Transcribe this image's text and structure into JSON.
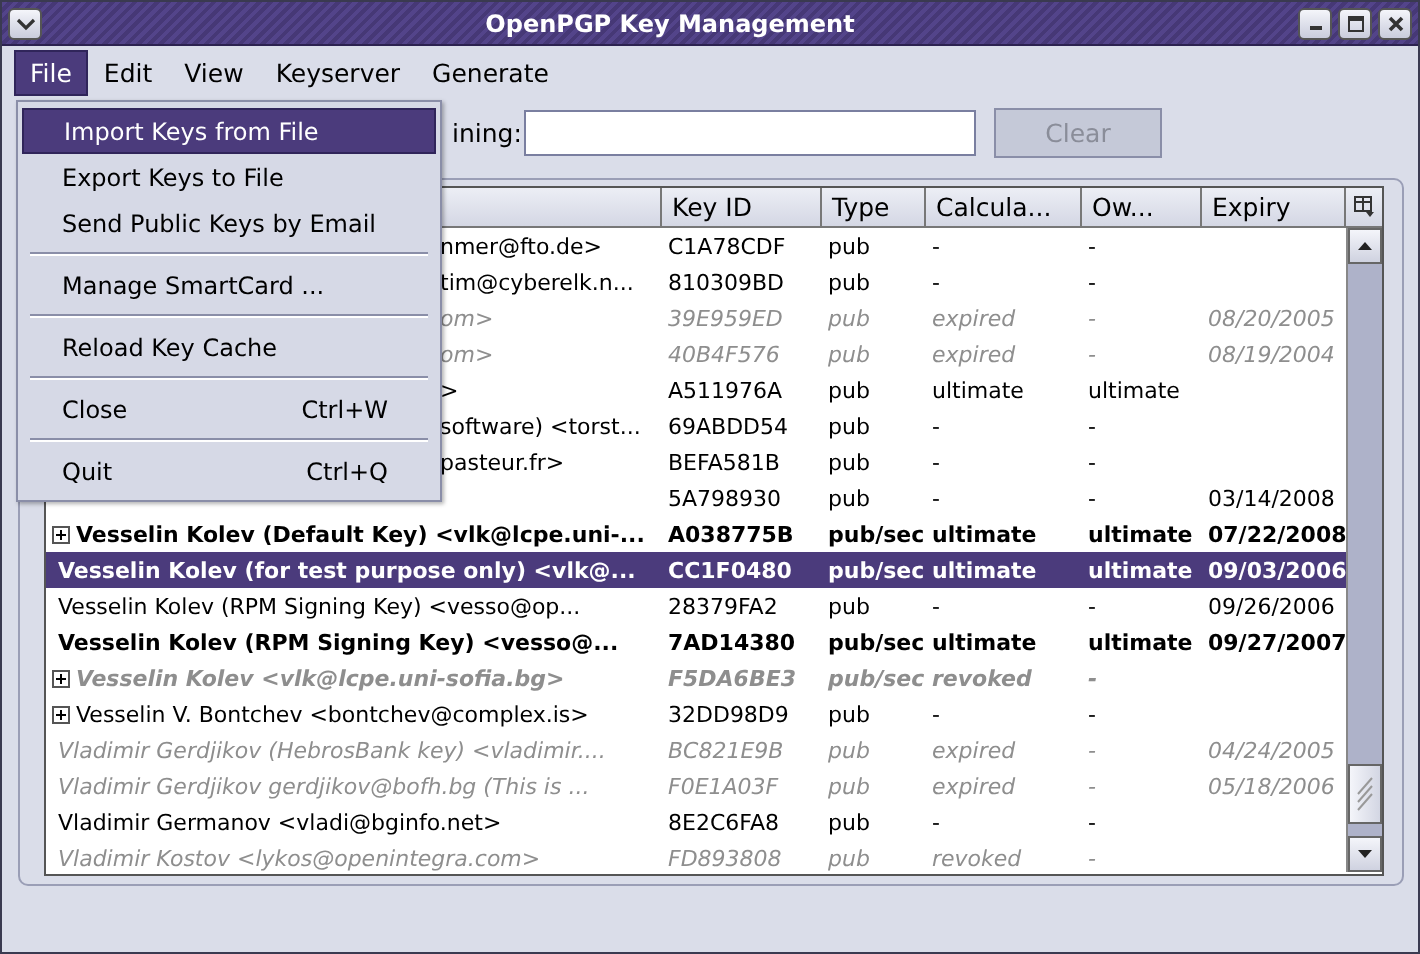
{
  "window": {
    "title": "OpenPGP Key Management"
  },
  "menubar": [
    {
      "label": "File",
      "selected": true
    },
    {
      "label": "Edit",
      "selected": false
    },
    {
      "label": "View",
      "selected": false
    },
    {
      "label": "Keyserver",
      "selected": false
    },
    {
      "label": "Generate",
      "selected": false
    }
  ],
  "file_menu": [
    {
      "kind": "item",
      "label": "Import Keys from File",
      "selected": true
    },
    {
      "kind": "item",
      "label": "Export Keys to File",
      "selected": false
    },
    {
      "kind": "item",
      "label": "Send Public Keys by Email",
      "selected": false
    },
    {
      "kind": "separator"
    },
    {
      "kind": "item",
      "label": "Manage SmartCard ...",
      "selected": false
    },
    {
      "kind": "separator"
    },
    {
      "kind": "item",
      "label": "Reload Key Cache",
      "selected": false
    },
    {
      "kind": "separator"
    },
    {
      "kind": "item",
      "label": "Close",
      "shortcut": "Ctrl+W",
      "selected": false
    },
    {
      "kind": "separator"
    },
    {
      "kind": "item",
      "label": "Quit",
      "shortcut": "Ctrl+Q",
      "selected": false
    }
  ],
  "search": {
    "label": "ining:",
    "button": "Clear",
    "button_disabled": true
  },
  "table": {
    "columns": [
      "Key ID",
      "Type",
      "Calcula...",
      "Ow...",
      "Expiry"
    ],
    "rows": [
      {
        "name": "nmer@fto.de>",
        "clipped": true,
        "key_id": "C1A78CDF",
        "type": "pub",
        "calculated": "-",
        "owner": "-",
        "bold": false,
        "invalid": false,
        "expandable": false,
        "selected": false
      },
      {
        "name": "tim@cyberelk.n...",
        "clipped": true,
        "key_id": "810309BD",
        "type": "pub",
        "calculated": "-",
        "owner": "-",
        "bold": false,
        "invalid": false,
        "expandable": false,
        "selected": false
      },
      {
        "name": "om>",
        "clipped": true,
        "key_id": "39E959ED",
        "type": "pub",
        "calculated": "expired",
        "owner": "-",
        "expiry": "08/20/2005",
        "bold": false,
        "invalid": true,
        "expandable": false,
        "selected": false
      },
      {
        "name": "om>",
        "clipped": true,
        "key_id": "40B4F576",
        "type": "pub",
        "calculated": "expired",
        "owner": "-",
        "expiry": "08/19/2004",
        "bold": false,
        "invalid": true,
        "expandable": false,
        "selected": false
      },
      {
        "name": ">",
        "clipped": true,
        "key_id": "A511976A",
        "type": "pub",
        "calculated": "ultimate",
        "owner": "ultimate",
        "bold": false,
        "invalid": false,
        "expandable": false,
        "selected": false
      },
      {
        "name": "software) <torst...",
        "clipped": true,
        "key_id": "69ABDD54",
        "type": "pub",
        "calculated": "-",
        "owner": "-",
        "bold": false,
        "invalid": false,
        "expandable": false,
        "selected": false
      },
      {
        "name": "pasteur.fr>",
        "clipped": true,
        "key_id": "BEFA581B",
        "type": "pub",
        "calculated": "-",
        "owner": "-",
        "bold": false,
        "invalid": false,
        "expandable": false,
        "selected": false
      },
      {
        "key_id": "5A798930",
        "type": "pub",
        "calculated": "-",
        "owner": "-",
        "expiry": "03/14/2008",
        "bold": false,
        "invalid": false,
        "expandable": false,
        "selected": false
      },
      {
        "name": "Vesselin Kolev (Default Key) <vlk@lcpe.uni-...",
        "key_id": "A038775B",
        "type": "pub/sec",
        "calculated": "ultimate",
        "owner": "ultimate",
        "expiry": "07/22/2008",
        "bold": true,
        "invalid": false,
        "expandable": true,
        "selected": false
      },
      {
        "name": "Vesselin Kolev (for test purpose only) <vlk@...",
        "key_id": "CC1F0480",
        "type": "pub/sec",
        "calculated": "ultimate",
        "owner": "ultimate",
        "expiry": "09/03/2006",
        "bold": true,
        "invalid": false,
        "expandable": false,
        "selected": true
      },
      {
        "name": "Vesselin Kolev (RPM Signing Key) <vesso@op...",
        "key_id": "28379FA2",
        "type": "pub",
        "calculated": "-",
        "owner": "-",
        "expiry": "09/26/2006",
        "bold": false,
        "invalid": false,
        "expandable": false,
        "selected": false
      },
      {
        "name": "Vesselin Kolev (RPM Signing Key) <vesso@...",
        "key_id": "7AD14380",
        "type": "pub/sec",
        "calculated": "ultimate",
        "owner": "ultimate",
        "expiry": "09/27/2007",
        "bold": true,
        "invalid": false,
        "expandable": false,
        "selected": false
      },
      {
        "name": "Vesselin Kolev <vlk@lcpe.uni-sofia.bg>",
        "key_id": "F5DA6BE3",
        "type": "pub/sec",
        "calculated": "revoked",
        "owner": "-",
        "bold": true,
        "invalid": true,
        "expandable": true,
        "selected": false
      },
      {
        "name": "Vesselin V. Bontchev <bontchev@complex.is>",
        "key_id": "32DD98D9",
        "type": "pub",
        "calculated": "-",
        "owner": "-",
        "bold": false,
        "invalid": false,
        "expandable": true,
        "selected": false
      },
      {
        "name": "Vladimir Gerdjikov (HebrosBank key) <vladimir....",
        "key_id": "BC821E9B",
        "type": "pub",
        "calculated": "expired",
        "owner": "-",
        "expiry": "04/24/2005",
        "bold": false,
        "invalid": true,
        "expandable": false,
        "selected": false
      },
      {
        "name": "Vladimir Gerdjikov gerdjikov@bofh.bg (This is ...",
        "key_id": "F0E1A03F",
        "type": "pub",
        "calculated": "expired",
        "owner": "-",
        "expiry": "05/18/2006",
        "bold": false,
        "invalid": true,
        "expandable": false,
        "selected": false
      },
      {
        "name": "Vladimir Germanov <vladi@bginfo.net>",
        "key_id": "8E2C6FA8",
        "type": "pub",
        "calculated": "-",
        "owner": "-",
        "bold": false,
        "invalid": false,
        "expandable": false,
        "selected": false
      },
      {
        "name": "Vladimir Kostov <lykos@openintegra.com>",
        "key_id": "FD893808",
        "type": "pub",
        "calculated": "revoked",
        "owner": "-",
        "bold": false,
        "invalid": true,
        "expandable": false,
        "selected": false
      }
    ]
  }
}
